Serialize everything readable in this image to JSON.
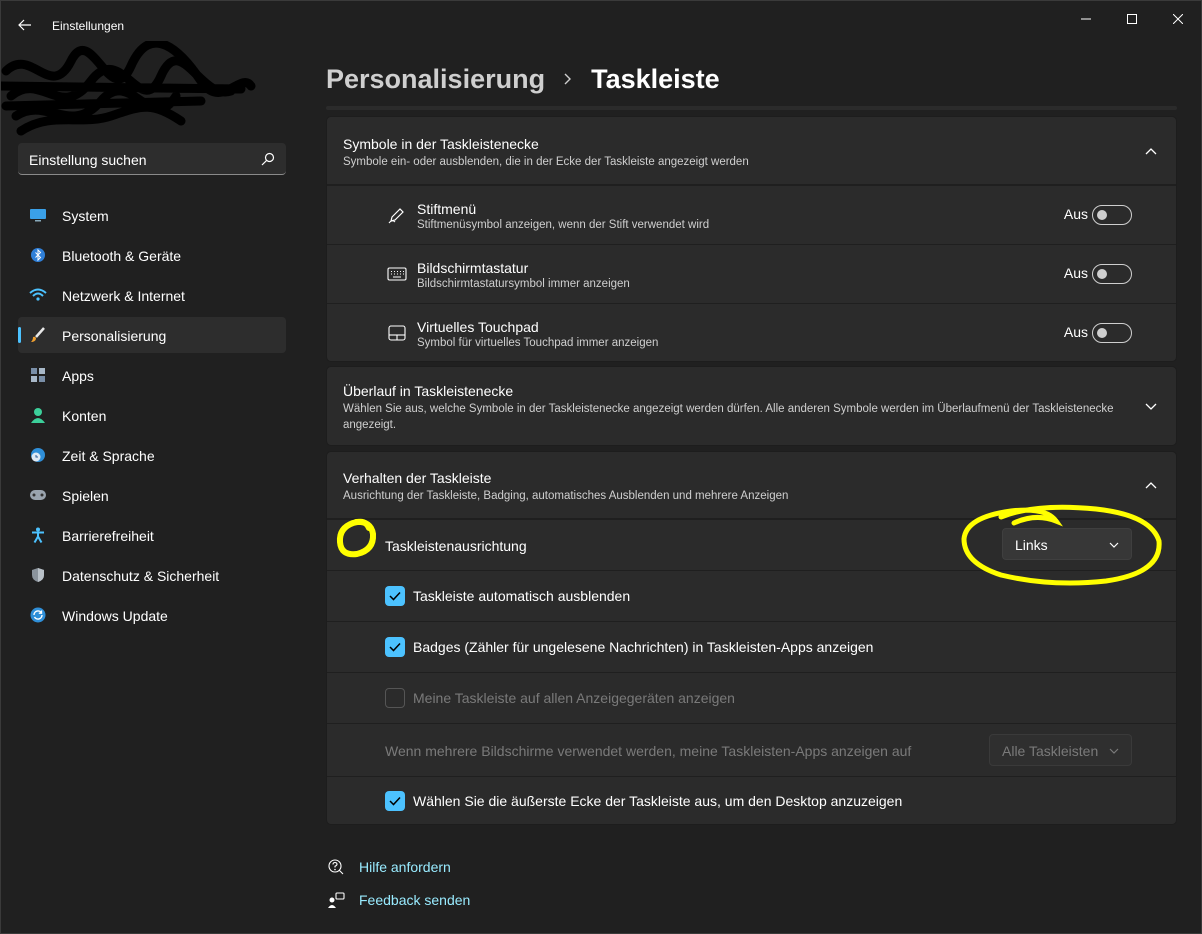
{
  "window": {
    "title": "Einstellungen"
  },
  "search": {
    "placeholder": "Einstellung suchen"
  },
  "sidebar": {
    "items": [
      {
        "label": "System",
        "icon": "monitor-icon"
      },
      {
        "label": "Bluetooth & Geräte",
        "icon": "bluetooth-icon"
      },
      {
        "label": "Netzwerk & Internet",
        "icon": "wifi-icon"
      },
      {
        "label": "Personalisierung",
        "icon": "brush-icon",
        "active": true
      },
      {
        "label": "Apps",
        "icon": "apps-icon"
      },
      {
        "label": "Konten",
        "icon": "person-icon"
      },
      {
        "label": "Zeit & Sprache",
        "icon": "globe-clock-icon"
      },
      {
        "label": "Spielen",
        "icon": "gamepad-icon"
      },
      {
        "label": "Barrierefreiheit",
        "icon": "accessibility-icon"
      },
      {
        "label": "Datenschutz & Sicherheit",
        "icon": "shield-icon"
      },
      {
        "label": "Windows Update",
        "icon": "update-icon"
      }
    ]
  },
  "header": {
    "parent": "Personalisierung",
    "current": "Taskleiste"
  },
  "corner_icons": {
    "title": "Symbole in der Taskleistenecke",
    "subtitle": "Symbole ein- oder ausblenden, die in der Ecke der Taskleiste angezeigt werden",
    "items": [
      {
        "title": "Stiftmenü",
        "subtitle": "Stiftmenüsymbol anzeigen, wenn der Stift verwendet wird",
        "state": "Aus",
        "icon": "pen-icon"
      },
      {
        "title": "Bildschirmtastatur",
        "subtitle": "Bildschirmtastatursymbol immer anzeigen",
        "state": "Aus",
        "icon": "keyboard-icon"
      },
      {
        "title": "Virtuelles Touchpad",
        "subtitle": "Symbol für virtuelles Touchpad immer anzeigen",
        "state": "Aus",
        "icon": "touchpad-icon"
      }
    ]
  },
  "overflow": {
    "title": "Überlauf in Taskleistenecke",
    "subtitle": "Wählen Sie aus, welche Symbole in der Taskleistenecke angezeigt werden dürfen. Alle anderen Symbole werden im Überlaufmenü der Taskleistenecke angezeigt."
  },
  "behavior": {
    "title": "Verhalten der Taskleiste",
    "subtitle": "Ausrichtung der Taskleiste, Badging, automatisches Ausblenden und mehrere Anzeigen",
    "alignment_label": "Taskleistenausrichtung",
    "alignment_value": "Links",
    "auto_hide": "Taskleiste automatisch ausblenden",
    "badges": "Badges (Zähler für ungelesene Nachrichten) in Taskleisten-Apps anzeigen",
    "all_displays": "Meine Taskleiste auf allen Anzeigegeräten anzeigen",
    "multi_display_label": "Wenn mehrere Bildschirme verwendet werden, meine Taskleisten-Apps anzeigen auf",
    "multi_display_value": "Alle Taskleisten",
    "far_corner": "Wählen Sie die äußerste Ecke der Taskleiste aus, um den Desktop anzuzeigen",
    "checked": {
      "auto_hide": true,
      "badges": true,
      "all_displays": false,
      "far_corner": true
    }
  },
  "footer": {
    "help": "Hilfe anfordern",
    "feedback": "Feedback senden"
  },
  "colors": {
    "accent": "#4cc2ff",
    "link": "#99ebff",
    "annotation": "#ffff00"
  }
}
